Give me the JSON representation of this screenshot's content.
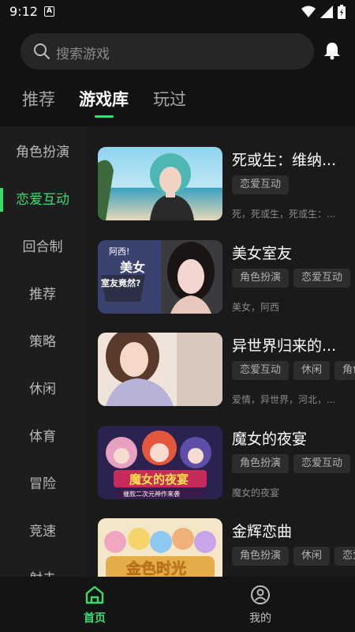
{
  "status": {
    "time": "9:12",
    "notif_badge": "A"
  },
  "search": {
    "placeholder": "搜索游戏"
  },
  "tabs": [
    {
      "label": "推荐"
    },
    {
      "label": "游戏库",
      "active": true
    },
    {
      "label": "玩过"
    }
  ],
  "categories": [
    {
      "label": "角色扮演"
    },
    {
      "label": "恋爱互动",
      "active": true
    },
    {
      "label": "回合制"
    },
    {
      "label": "推荐"
    },
    {
      "label": "策略"
    },
    {
      "label": "休闲"
    },
    {
      "label": "体育"
    },
    {
      "label": "冒险"
    },
    {
      "label": "竞速"
    },
    {
      "label": "射击"
    }
  ],
  "games": [
    {
      "title": "死或生：维纳...",
      "tags": [
        "恋爱互动"
      ],
      "desc": "死，死或生，死或生：..."
    },
    {
      "title": "美女室友",
      "tags": [
        "角色扮演",
        "恋爱互动"
      ],
      "desc": "美女，阿西",
      "cover_text_1": "阿西!",
      "cover_text_2": "美女",
      "cover_text_3": "室友竟然?"
    },
    {
      "title": "异世界归来的...",
      "tags": [
        "恋爱互动",
        "休闲",
        "角色扮演"
      ],
      "desc": "爱情，异世界，河北，..."
    },
    {
      "title": "魔女的夜宴",
      "tags": [
        "角色扮演",
        "恋爱互动"
      ],
      "desc": "魔女的夜宴",
      "cover_text_1": "魔女的夜宴",
      "cover_text_2": "催款二次元神作来袭"
    },
    {
      "title": "金辉恋曲",
      "tags": [
        "角色扮演",
        "休闲",
        "恋爱互动"
      ],
      "desc": "",
      "cover_text_1": "金色时光"
    }
  ],
  "bottom_nav": [
    {
      "label": "首页",
      "active": true
    },
    {
      "label": "我的"
    }
  ],
  "colors": {
    "accent": "#3ddc73",
    "bg": "#1a1a1a"
  }
}
